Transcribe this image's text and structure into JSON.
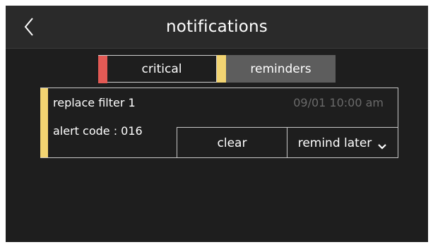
{
  "header": {
    "title": "notifications",
    "back_icon": "chevron-left-icon"
  },
  "tabs": [
    {
      "label": "critical",
      "marker_color": "#e35a55",
      "selected": false
    },
    {
      "label": "reminders",
      "marker_color": "#f2d472",
      "selected": true
    }
  ],
  "notification": {
    "title": "replace filter 1",
    "timestamp": "09/01 10:00 am",
    "alert_code": "alert code : 016",
    "marker_color": "#f2d472",
    "actions": {
      "clear_label": "clear",
      "remind_label": "remind later",
      "remind_icon": "chevron-down-icon"
    }
  },
  "colors": {
    "background": "#1e1e1e",
    "header_background": "#2a2a2a",
    "selected_tab": "#5d5d5d",
    "muted_text": "#6a6a6a"
  }
}
